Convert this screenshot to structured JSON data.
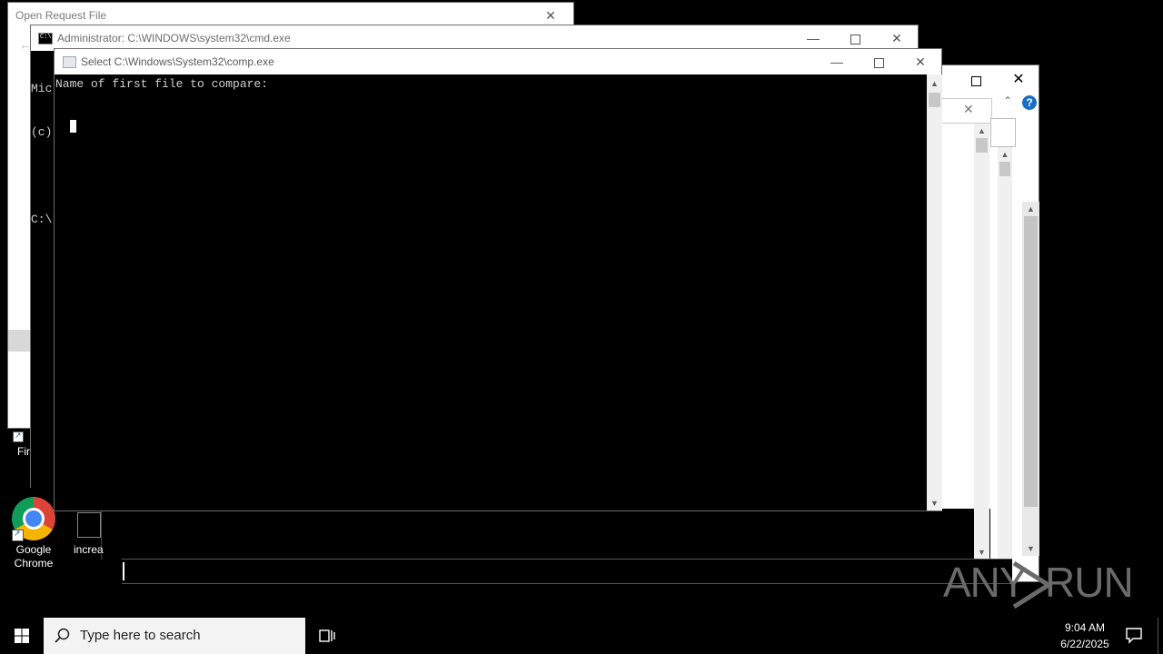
{
  "windows": {
    "open_request": {
      "title": "Open Request File"
    },
    "cmd": {
      "title": "Administrator: C:\\WINDOWS\\system32\\cmd.exe",
      "lines": [
        "Mic",
        "(c)",
        "",
        "C:\\"
      ]
    },
    "comp": {
      "title": "Select C:\\Windows\\System32\\comp.exe",
      "prompt": "Name of first file to compare:"
    }
  },
  "desktop": {
    "icons": [
      {
        "label": "Fir"
      },
      {
        "label": "Google\nChrome"
      },
      {
        "label": "increa"
      }
    ]
  },
  "taskbar": {
    "search_placeholder": "Type here to search",
    "time": "9:04 AM",
    "date": "6/22/2025"
  },
  "watermark": {
    "left": "ANY",
    "right": "RUN"
  },
  "icons": {
    "start": "windows-start-icon",
    "search": "search-icon",
    "taskview": "task-view-icon",
    "notifications": "notification-icon",
    "help": "help-icon"
  },
  "colors": {
    "help_blue": "#1a6fc4",
    "chrome_red": "#db4437",
    "chrome_green": "#0f9d58",
    "chrome_yellow": "#f4b400",
    "chrome_blue": "#4285f4"
  }
}
